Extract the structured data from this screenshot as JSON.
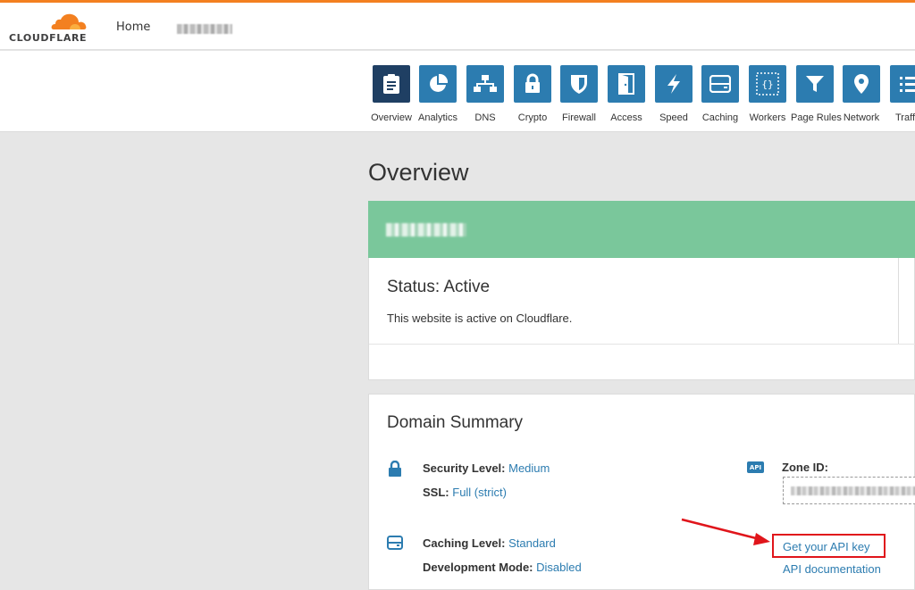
{
  "header": {
    "logo_text": "CLOUDFLARE",
    "home_label": "Home",
    "accent_color": "#f38020"
  },
  "apps": [
    {
      "label": "Overview",
      "icon": "clipboard-icon",
      "active": true
    },
    {
      "label": "Analytics",
      "icon": "pie-chart-icon"
    },
    {
      "label": "DNS",
      "icon": "network-tree-icon"
    },
    {
      "label": "Crypto",
      "icon": "lock-icon"
    },
    {
      "label": "Firewall",
      "icon": "shield-icon"
    },
    {
      "label": "Access",
      "icon": "door-icon"
    },
    {
      "label": "Speed",
      "icon": "lightning-icon"
    },
    {
      "label": "Caching",
      "icon": "server-icon"
    },
    {
      "label": "Workers",
      "icon": "braces-icon"
    },
    {
      "label": "Page Rules",
      "icon": "filter-icon"
    },
    {
      "label": "Network",
      "icon": "location-pin-icon"
    },
    {
      "label": "Traff",
      "icon": "list-icon"
    }
  ],
  "main": {
    "page_title": "Overview",
    "status": {
      "title": "Status: Active",
      "description": "This website is active on Cloudflare."
    },
    "summary": {
      "title": "Domain Summary",
      "security_label": "Security Level:",
      "security_value": "Medium",
      "ssl_label": "SSL:",
      "ssl_value": "Full (strict)",
      "caching_label": "Caching Level:",
      "caching_value": "Standard",
      "devmode_label": "Development Mode:",
      "devmode_value": "Disabled",
      "api_badge": "API",
      "zone_label": "Zone ID:",
      "api_key_link": "Get your API key",
      "api_doc_link": "API documentation"
    }
  },
  "colors": {
    "brand_blue": "#2c7cb0",
    "active_tile": "#1f3f63",
    "banner_green": "#7ac79b",
    "highlight_red": "#e0151b"
  }
}
